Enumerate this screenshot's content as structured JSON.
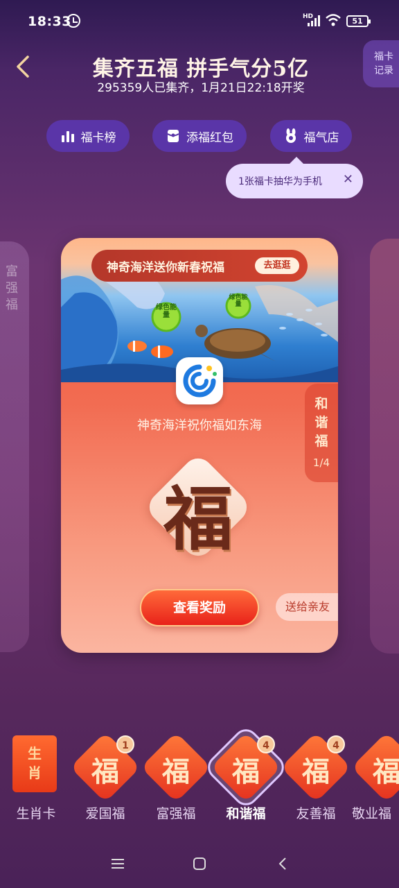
{
  "status_bar": {
    "time": "18:33",
    "network_label": "HD",
    "battery": "51"
  },
  "header": {
    "title": "集齐五福 拼手气分5亿",
    "subtitle": "295359人已集齐，1月21日22:18开奖",
    "record_label": "福卡记录"
  },
  "actions": [
    {
      "label": "福卡榜",
      "icon": "bar-chart-icon"
    },
    {
      "label": "添福红包",
      "icon": "red-packet-icon"
    },
    {
      "label": "福气店",
      "icon": "rabbit-shop-icon"
    }
  ],
  "tooltip": {
    "text": "1张福卡抽华为手机",
    "close": "✕"
  },
  "left_ghost_card": {
    "label": "富强福"
  },
  "card": {
    "banner_text": "神奇海洋送你新春祝福",
    "banner_button": "去逛逛",
    "energy_label": "绿色能量",
    "subtitle": "神奇海洋祝你福如东海",
    "card_name": "和谐福",
    "card_count": "1/4",
    "fu_char": "福",
    "view_button": "查看奖励",
    "send_button": "送给亲友"
  },
  "tray": [
    {
      "label": "生肖卡",
      "char": "生肖",
      "badge": "",
      "type": "zodiac"
    },
    {
      "label": "爱国福",
      "char": "福",
      "badge": "1",
      "type": "fu"
    },
    {
      "label": "富强福",
      "char": "福",
      "badge": "",
      "type": "fu"
    },
    {
      "label": "和谐福",
      "char": "福",
      "badge": "4",
      "type": "fu",
      "active": true
    },
    {
      "label": "友善福",
      "char": "福",
      "badge": "4",
      "type": "fu"
    },
    {
      "label": "敬业福",
      "char": "福",
      "badge": "",
      "type": "fu"
    }
  ],
  "colors": {
    "accent_purple": "#5a35a8",
    "card_red": "#f0553a",
    "gold": "#ffc98a"
  }
}
